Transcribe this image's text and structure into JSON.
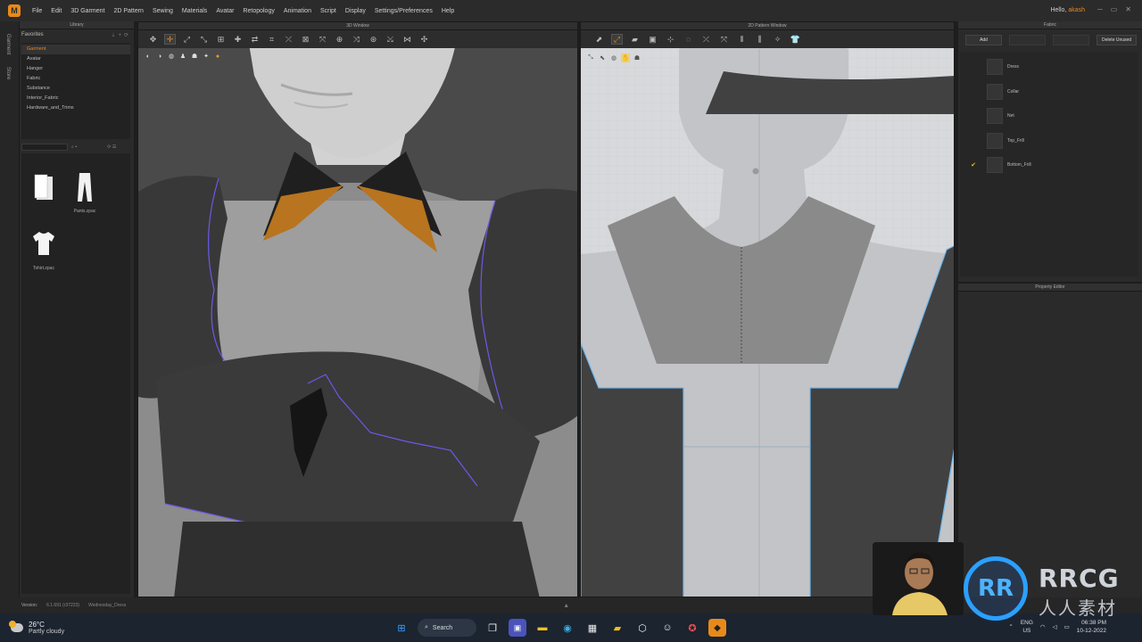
{
  "menu": {
    "logo": "M",
    "items": [
      "File",
      "Edit",
      "3D Garment",
      "2D Pattern",
      "Sewing",
      "Materials",
      "Avatar",
      "Retopology",
      "Animation",
      "Script",
      "Display",
      "Settings/Preferences",
      "Help"
    ],
    "hello_prefix": "Hello,",
    "user": "akash"
  },
  "left_strip": {
    "tabs": [
      "Garment",
      "Store"
    ]
  },
  "library": {
    "title": "Library",
    "favorites_label": "Favorites",
    "tree": [
      "Garment",
      "Avatar",
      "Hanger",
      "Fabric",
      "Substance",
      "Interior_Fabric",
      "Hardware_and_Trims"
    ],
    "selected": "Garment",
    "files": [
      {
        "name": "",
        "icon": "folder-icon"
      },
      {
        "name": "Pants.zpac",
        "icon": "pants-icon"
      },
      {
        "name": "Tshirt.zpac",
        "icon": "tshirt-icon"
      }
    ]
  },
  "window3d": {
    "title": "3D Window"
  },
  "window2d": {
    "title": "2D Pattern Window"
  },
  "fabric": {
    "title": "Fabric",
    "buttons": [
      "Add",
      "",
      "",
      "Delete Unused"
    ],
    "items": [
      {
        "name": "Dress",
        "checked": false
      },
      {
        "name": "Collar",
        "checked": false
      },
      {
        "name": "Net",
        "checked": false
      },
      {
        "name": "Top_Frill",
        "checked": false
      },
      {
        "name": "Bottom_Frill",
        "checked": true
      }
    ]
  },
  "property_editor": {
    "title": "Property Editor"
  },
  "status": {
    "version_label": "Version:",
    "version": "6.1.691 (r37223)",
    "file": "Wednesday_Dress"
  },
  "taskbar": {
    "temperature": "26°C",
    "weather": "Partly cloudy",
    "search": "Search",
    "lang1": "ENG",
    "lang2": "US",
    "time": "06:38 PM",
    "date": "10-12-2022"
  },
  "watermark": {
    "logo_text": "RR",
    "brand": "RRCG",
    "cn": "人人素材"
  },
  "colors": {
    "accent": "#e88a1a",
    "seam": "#5a5ae8",
    "pattern_dark": "#3d3d3d",
    "outline_blue": "#6fb8f0"
  }
}
